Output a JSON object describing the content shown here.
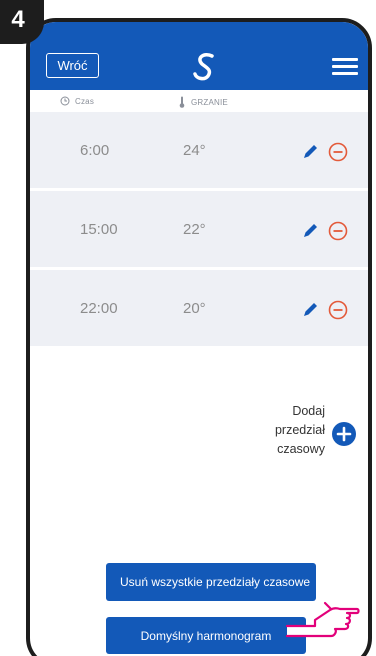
{
  "step_number": "4",
  "header": {
    "back_label": "Wróć",
    "logo_icon": "salus-logo-icon",
    "menu_icon": "hamburger-menu-icon"
  },
  "columns": {
    "time_label": "Czas",
    "heating_label": "GRZANIE"
  },
  "intervals": [
    {
      "time": "6:00",
      "temp": "24°"
    },
    {
      "time": "15:00",
      "temp": "22°"
    },
    {
      "time": "22:00",
      "temp": "20°"
    }
  ],
  "add_interval": {
    "line1": "Dodaj",
    "line2": "przedział",
    "line3": "czasowy"
  },
  "buttons": {
    "delete_all": "Usuń wszystkie przedziały czasowe",
    "default_schedule": "Domyślny harmonogram"
  },
  "colors": {
    "primary": "#1359b8",
    "row_bg": "#eef0f5",
    "remove": "#e35a3a"
  }
}
